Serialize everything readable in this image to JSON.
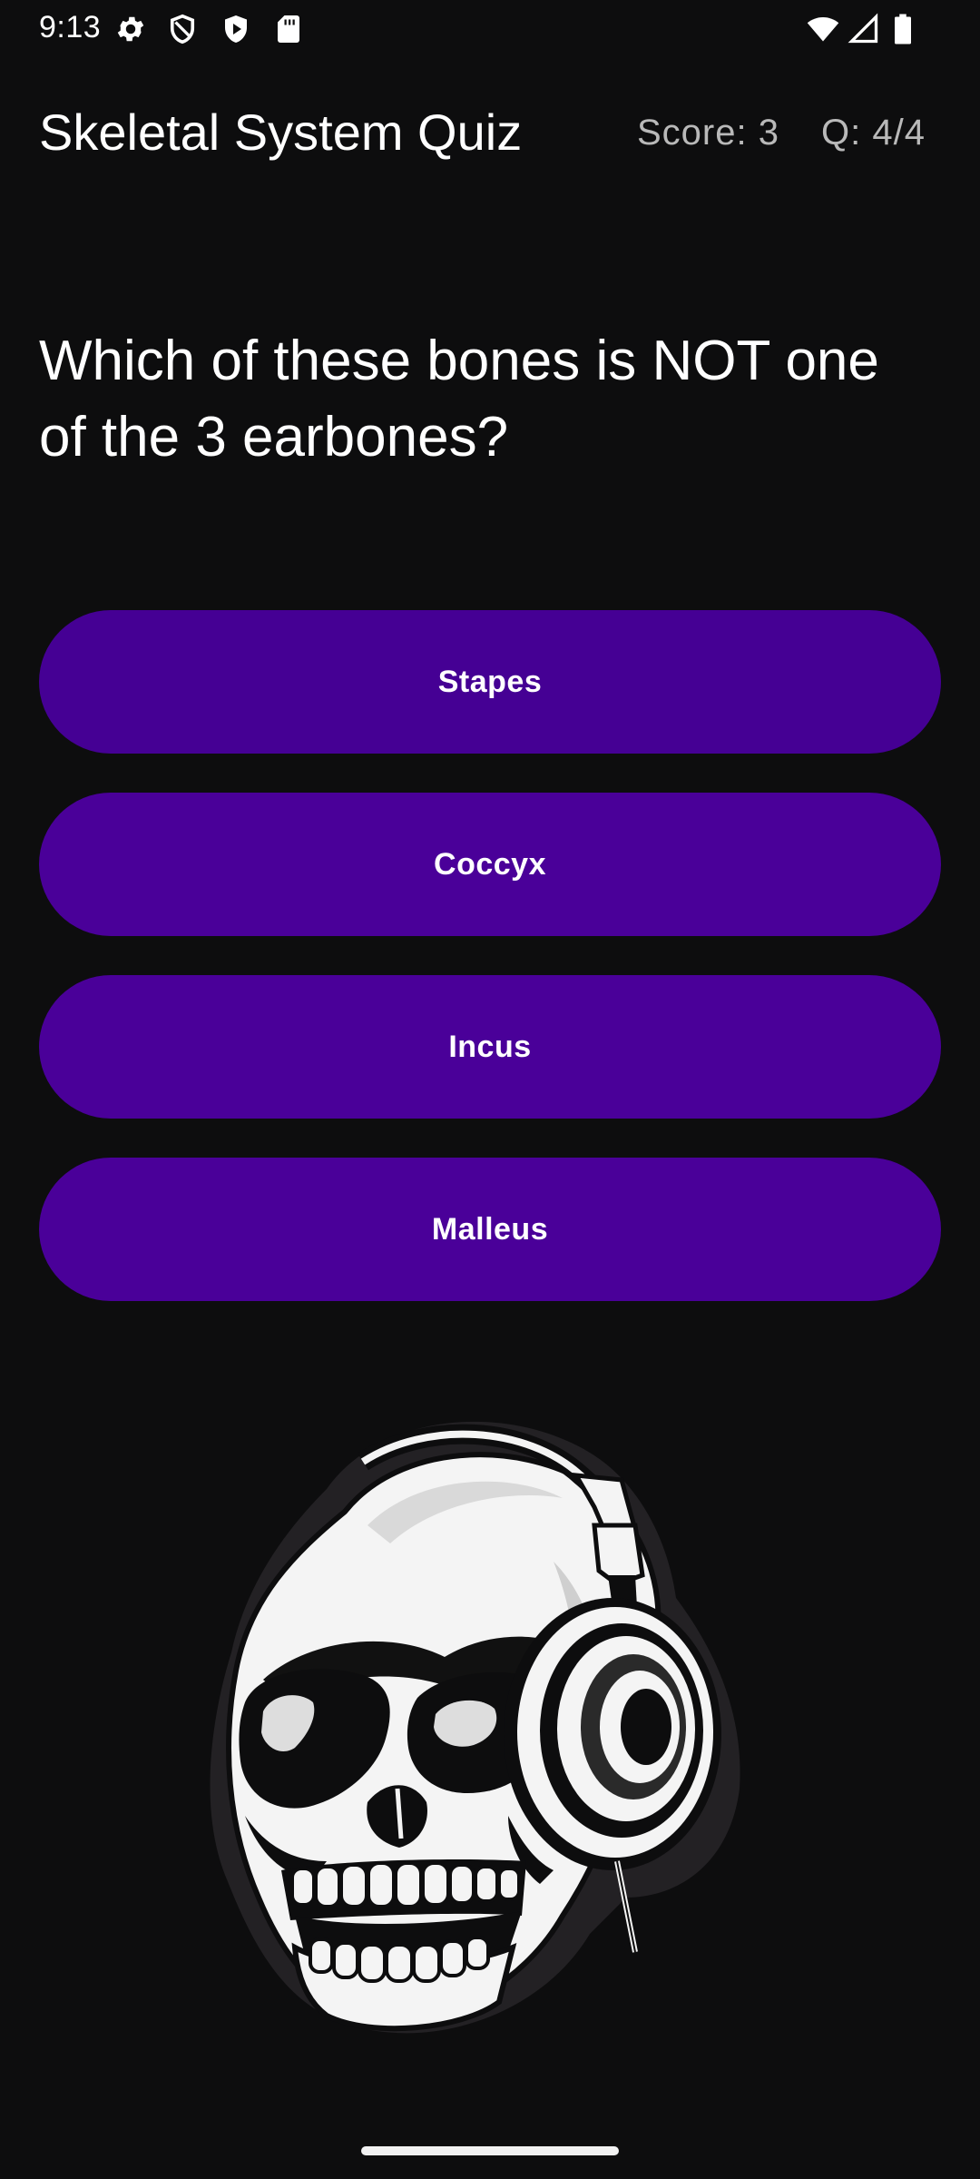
{
  "status_bar": {
    "time": "9:13",
    "left_icons": [
      "settings-icon",
      "shield-icon",
      "play-protect-icon",
      "sd-card-icon"
    ],
    "right_icons": [
      "wifi-icon",
      "cell-signal-icon",
      "battery-icon"
    ]
  },
  "header": {
    "title": "Skeletal System Quiz",
    "score": "Score: 3",
    "question_counter": "Q: 4/4"
  },
  "question": {
    "text": "Which of these bones is NOT one of the 3 earbones?"
  },
  "answers": [
    {
      "label": "Stapes"
    },
    {
      "label": "Coccyx"
    },
    {
      "label": "Incus"
    },
    {
      "label": "Malleus"
    }
  ],
  "illustration": {
    "icon": "skull-headphones-illustration"
  },
  "colors": {
    "background": "#0d0d0e",
    "answer_button": "#4a0099",
    "header_secondary_text": "#b9b9b9",
    "text": "#ffffff"
  }
}
